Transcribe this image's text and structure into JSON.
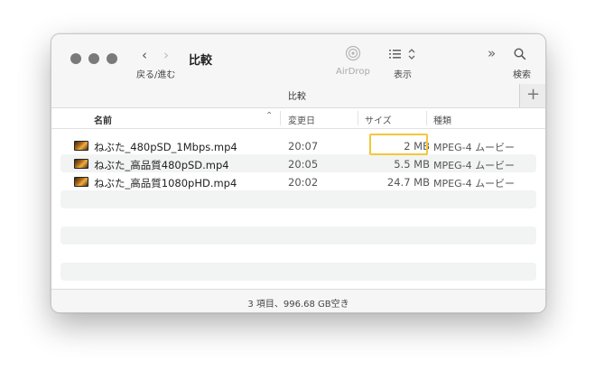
{
  "window": {
    "title": "比較",
    "nav_label": "戻る/進む",
    "toolbar": {
      "airdrop_label": "AirDrop",
      "view_label": "表示",
      "search_label": "検索"
    }
  },
  "tab": {
    "label": "比較",
    "add_symbol": "+"
  },
  "columns": {
    "name": "名前",
    "date": "変更日",
    "size": "サイズ",
    "kind": "種類"
  },
  "files": [
    {
      "name": "ねぶた_480pSD_1Mbps.mp4",
      "date": "20:07",
      "size": "2 MB",
      "kind": "MPEG-4 ムービー"
    },
    {
      "name": "ねぶた_高品質480pSD.mp4",
      "date": "20:05",
      "size": "5.5 MB",
      "kind": "MPEG-4 ムービー"
    },
    {
      "name": "ねぶた_高品質1080pHD.mp4",
      "date": "20:02",
      "size": "24.7 MB",
      "kind": "MPEG-4 ムービー"
    }
  ],
  "status": "3 項目、996.68 GB空き",
  "colors": {
    "highlight": "#f2c83a",
    "traffic_light": "#7a7a7a",
    "row_alt": "#f2f4f4"
  }
}
